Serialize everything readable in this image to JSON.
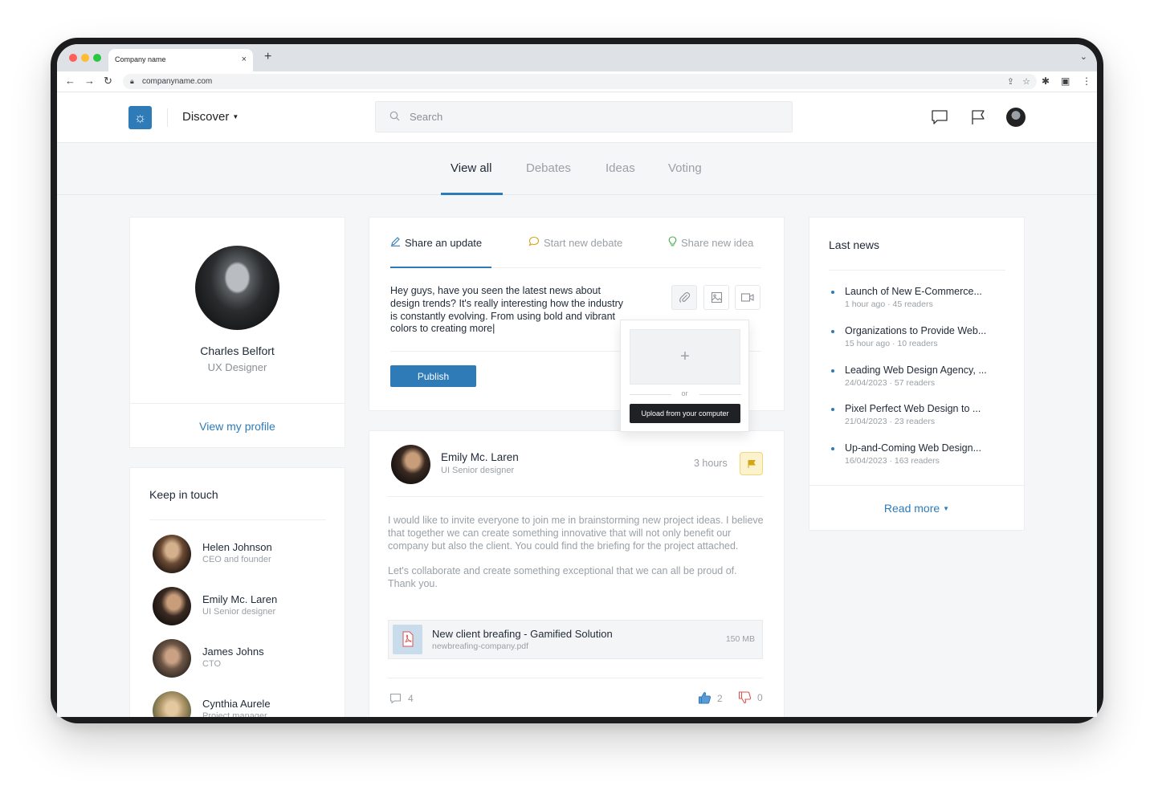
{
  "browser": {
    "tab_title": "Company name",
    "tab_close": "×",
    "new_tab": "+",
    "tab_menu": "⌄",
    "url": "companyname.com"
  },
  "header": {
    "nav_label": "Discover",
    "search_placeholder": "Search"
  },
  "filter_tabs": [
    "View all",
    "Debates",
    "Ideas",
    "Voting"
  ],
  "profile": {
    "name": "Charles Belfort",
    "role": "UX Designer",
    "view_profile": "View my profile"
  },
  "keep_in_touch": {
    "title": "Keep in touch",
    "contacts": [
      {
        "name": "Helen Johnson",
        "role": "CEO and founder"
      },
      {
        "name": "Emily Mc. Laren",
        "role": "UI Senior designer"
      },
      {
        "name": "James Johns",
        "role": "CTO"
      },
      {
        "name": "Cynthia Aurele",
        "role": "Project manager"
      }
    ]
  },
  "composer": {
    "tabs": [
      "Share an update",
      "Start new debate",
      "Share new idea"
    ],
    "text": "Hey guys, have you seen the latest news about design trends? It's really interesting how the industry is constantly evolving. From using bold and vibrant colors to creating more|",
    "publish": "Publish",
    "upload": {
      "plus": "+",
      "or": "or",
      "button": "Upload from your computer"
    }
  },
  "post": {
    "author": "Emily Mc. Laren",
    "role": "UI Senior designer",
    "time": "3 hours",
    "body": [
      "I would like to invite everyone to join me in brainstorming new project ideas. I believe that together we can create something innovative that will not only benefit our company but also the client. You could find the briefing for the project attached.",
      "Let's collaborate and create something exceptional that we can all be proud of. Thank you."
    ],
    "attachment": {
      "title": "New client breafing - Gamified Solution",
      "filename": "newbreafing-company.pdf",
      "size": "150 MB"
    },
    "comments": "4",
    "likes": "2",
    "dislikes": "0"
  },
  "news": {
    "title": "Last news",
    "items": [
      {
        "headline": "Launch of New E-Commerce...",
        "meta": "1 hour ago · 45 readers"
      },
      {
        "headline": "Organizations to Provide Web...",
        "meta": "15 hour ago · 10 readers"
      },
      {
        "headline": "Leading Web Design Agency, ...",
        "meta": "24/04/2023 · 57 readers"
      },
      {
        "headline": "Pixel Perfect Web Design to ...",
        "meta": "21/04/2023 · 23 readers"
      },
      {
        "headline": "Up-and-Coming Web Design...",
        "meta": "16/04/2023 · 163 readers"
      }
    ],
    "read_more": "Read more"
  },
  "colors": {
    "accent": "#2e7bb8",
    "flag": "#f1d67a"
  },
  "icons": [
    "search-icon",
    "chat-icon",
    "flag-icon",
    "pencil-icon",
    "bubble-icon",
    "bulb-icon",
    "paperclip-icon",
    "image-icon",
    "video-icon",
    "pdf-icon",
    "comment-icon",
    "thumbs-up-icon",
    "thumbs-down-icon",
    "sun-logo-icon",
    "lock-icon",
    "share-icon",
    "star-icon",
    "puzzle-icon",
    "sidebar-icon",
    "more-icon"
  ]
}
